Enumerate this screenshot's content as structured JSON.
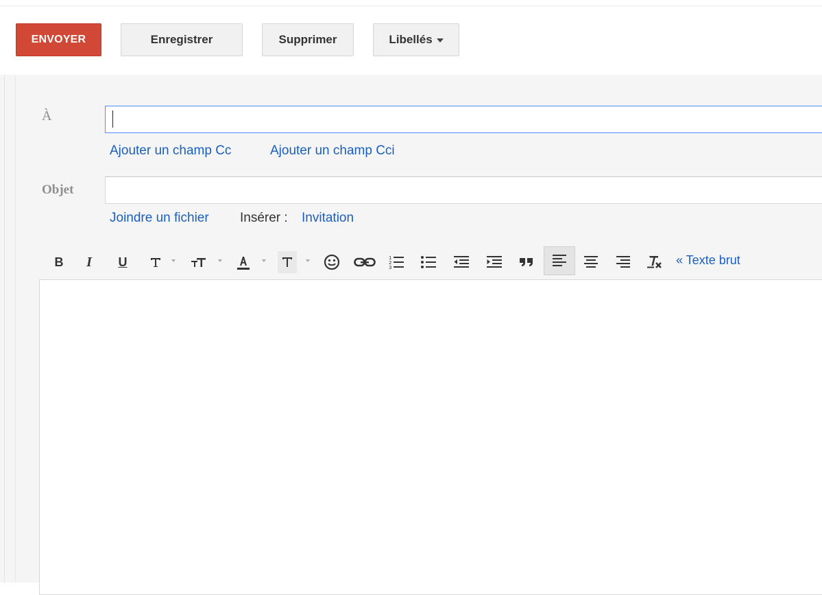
{
  "toolbar": {
    "send_label": "ENVOYER",
    "save_label": "Enregistrer",
    "delete_label": "Supprimer",
    "labels_label": "Libellés"
  },
  "compose": {
    "to_label": "À",
    "to_value": "",
    "add_cc": "Ajouter un champ Cc",
    "add_bcc": "Ajouter un champ Cci",
    "subject_label": "Objet",
    "subject_value": "",
    "attach_file": "Joindre un fichier",
    "insert_label": "Insérer :",
    "invitation": "Invitation",
    "body_value": ""
  },
  "format": {
    "bold": "B",
    "italic": "I",
    "underline": "U",
    "plain_text_link": "« Texte brut",
    "active_align": "align-left"
  },
  "colors": {
    "send_button": "#d14836",
    "link": "#1a5fbf",
    "focus_border": "#4d90fe"
  }
}
